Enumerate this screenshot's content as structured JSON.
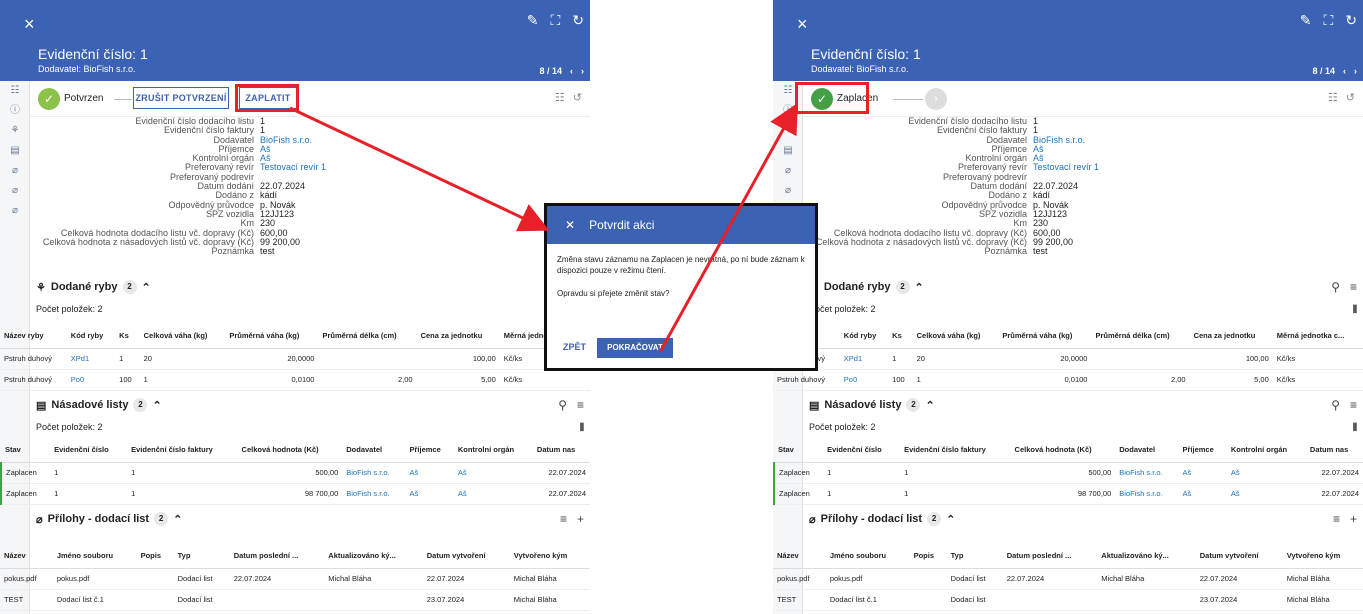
{
  "left": {
    "close_icon": "×",
    "title": "Evidenční číslo: 1",
    "subtitle": "Dodavatel: BioFish s.r.o.",
    "pager": "8 / 14",
    "status": "Potvrzen",
    "btn_cancel": "ZRUŠIT POTVRZENÍ",
    "btn_pay": "ZAPLATIT"
  },
  "right": {
    "close_icon": "×",
    "title": "Evidenční číslo: 1",
    "subtitle": "Dodavatel: BioFish s.r.o.",
    "pager": "8 / 14",
    "status": "Zaplacen"
  },
  "details": [
    {
      "label": "Evidenční číslo dodacího listu",
      "value": "1"
    },
    {
      "label": "Evidenční číslo faktury",
      "value": "1"
    },
    {
      "label": "Dodavatel",
      "value": "BioFish s.r.o.",
      "link": true
    },
    {
      "label": "Příjemce",
      "value": "Aš",
      "link": true
    },
    {
      "label": "Kontrolní orgán",
      "value": "Aš",
      "link": true
    },
    {
      "label": "Preferovaný revír",
      "value": "Testovací revír 1",
      "link": true
    },
    {
      "label": "Preferovaný podrevír",
      "value": ""
    },
    {
      "label": "Datum dodání",
      "value": "22.07.2024"
    },
    {
      "label": "Dodáno z",
      "value": "kádí"
    },
    {
      "label": "Odpovědný průvodce",
      "value": "p. Novák"
    },
    {
      "label": "SPZ vozidla",
      "value": "12JJ123"
    },
    {
      "label": "Km",
      "value": "230"
    },
    {
      "label": "Celková hodnota dodacího listu vč. dopravy (Kč)",
      "value": "600,00"
    },
    {
      "label": "Celková hodnota z násadových listů vč. dopravy (Kč)",
      "value": "99 200,00"
    },
    {
      "label": "Poznámka",
      "value": "test"
    }
  ],
  "fish": {
    "title": "Dodané ryby",
    "badge": "2",
    "count": "Počet položek: 2",
    "columns": [
      "Název ryby",
      "Kód ryby",
      "Ks",
      "Celková váha (kg)",
      "Průměrná váha (kg)",
      "Průměrná délka (cm)",
      "Cena za jednotku",
      "Měrná jednotka c..."
    ],
    "rows": [
      [
        "Pstruh duhový",
        "XPd1",
        "1",
        "20",
        "20,0000",
        "",
        "100,00",
        "Kč/ks"
      ],
      [
        "Pstruh duhový",
        "Po0",
        "100",
        "1",
        "0,0100",
        "2,00",
        "5,00",
        "Kč/ks"
      ]
    ]
  },
  "stocking": {
    "title": "Násadové listy",
    "badge": "2",
    "count": "Počet položek: 2",
    "columns": [
      "Stav",
      "Evidenční číslo",
      "Evidenční číslo faktury",
      "Celková hodnota (Kč)",
      "Dodavatel",
      "Příjemce",
      "Kontrolní orgán",
      "Datum nas"
    ],
    "rows": [
      [
        "Zaplacen",
        "1",
        "1",
        "500,00",
        "BioFish s.r.o.",
        "Aš",
        "Aš",
        "22.07.2024"
      ],
      [
        "Zaplacen",
        "1",
        "1",
        "98 700,00",
        "BioFish s.r.o.",
        "Aš",
        "Aš",
        "22.07.2024"
      ]
    ]
  },
  "attachments": {
    "title": "Přílohy - dodací list",
    "badge": "2",
    "columns": [
      "Název",
      "Jméno souboru",
      "Popis",
      "Typ",
      "Datum poslední ...",
      "Aktualizováno ký...",
      "Datum vytvoření",
      "Vytvořeno kým"
    ],
    "rows": [
      [
        "pokus.pdf",
        "pokus.pdf",
        "",
        "Dodací list",
        "22.07.2024",
        "Michal Bláha",
        "22.07.2024",
        "Michal Bláha"
      ],
      [
        "TEST",
        "Dodací list č.1",
        "",
        "Dodací list",
        "",
        "",
        "23.07.2024",
        "Michal Bláha"
      ]
    ]
  },
  "dialog": {
    "title": "Potvrdit akci",
    "message": "Změna stavu záznamu na Zaplacen je nevratná, po ní bude záznam k dispozici pouze v režimu čtení.",
    "question": "Opravdu si přejete změnit stav?",
    "back": "ZPĚT",
    "continue": "POKRAČOVAT"
  },
  "icons": {
    "edit": "pencil-icon",
    "fullscreen": "expand-icon",
    "refresh": "refresh-icon",
    "search": "search-icon",
    "menu": "list-icon",
    "add": "plus-icon",
    "history": "history-icon"
  }
}
